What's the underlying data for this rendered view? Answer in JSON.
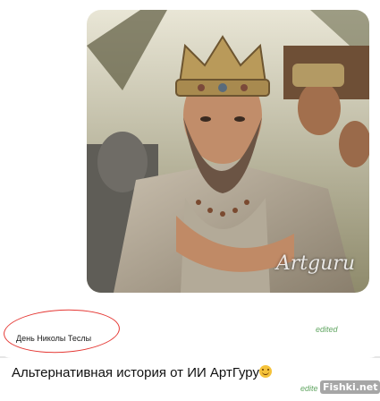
{
  "image": {
    "watermark": "Artguru",
    "icon": "portrait-image"
  },
  "reply": {
    "text": "День Николы Теслы",
    "edited": "edited"
  },
  "caption": {
    "text": "Альтернативная история от ИИ АртГуру",
    "emoji": "smile-emoji",
    "edited": "edite"
  },
  "badge": {
    "text": "Fishki.net"
  },
  "colors": {
    "annotation": "#e53935",
    "edited": "#62a663",
    "bubble": "#ffffff"
  }
}
